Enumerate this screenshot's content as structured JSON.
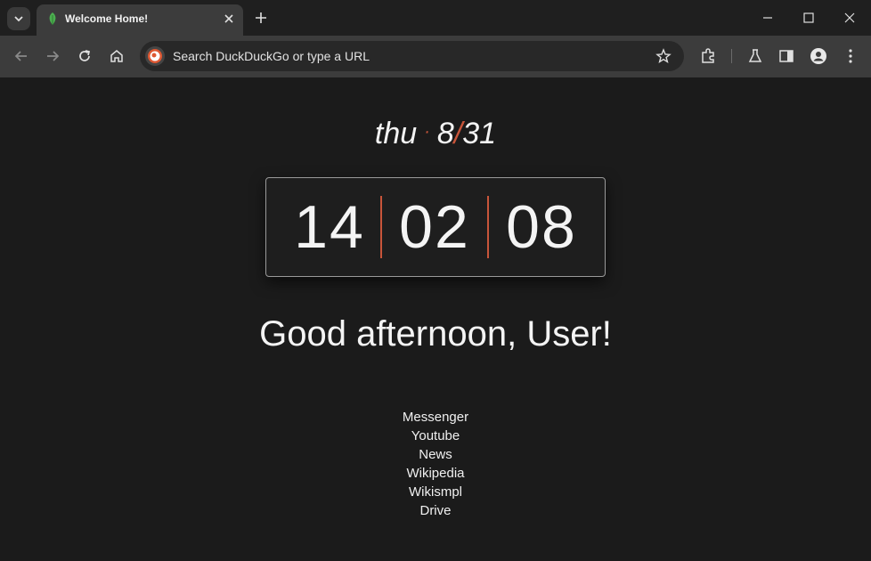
{
  "browser": {
    "tab": {
      "title": "Welcome Home!"
    },
    "omnibox": {
      "text": "Search DuckDuckGo or type a URL"
    }
  },
  "page": {
    "date": {
      "weekday": "thu",
      "separator": "·",
      "month": "8",
      "slash": "/",
      "day": "31"
    },
    "clock": {
      "hours": "14",
      "minutes": "02",
      "seconds": "08"
    },
    "greeting": "Good afternoon, User!",
    "links": [
      "Messenger",
      "Youtube",
      "News",
      "Wikipedia",
      "Wikismpl",
      "Drive"
    ]
  },
  "colors": {
    "accent": "#c8553a",
    "background": "#1b1b1b",
    "toolbar": "#3c3c3c"
  }
}
